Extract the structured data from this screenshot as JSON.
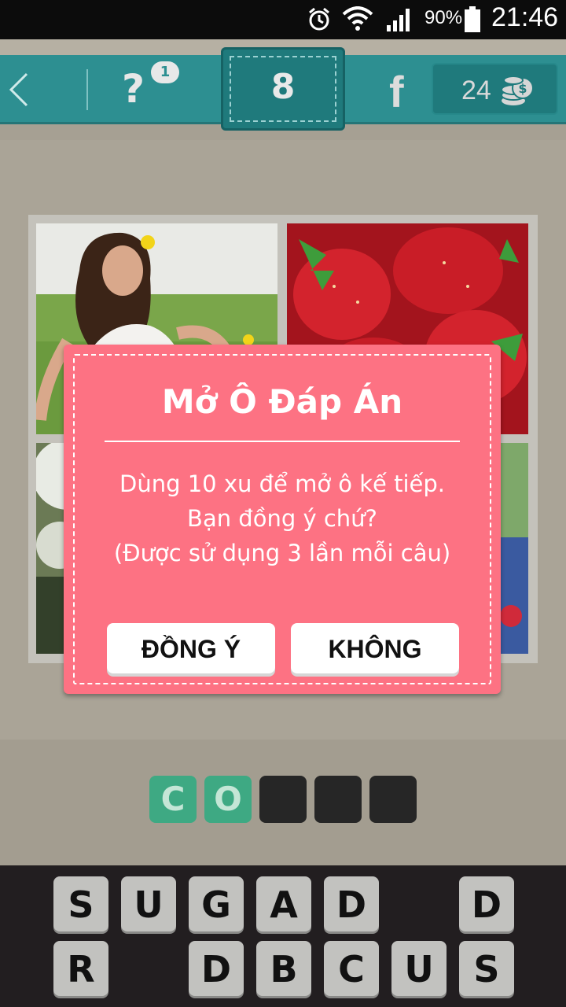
{
  "status_bar": {
    "battery": "90%",
    "time": "21:46"
  },
  "toolbar": {
    "hint_symbol": "?",
    "hint_count": "1",
    "level": "8",
    "facebook_label": "f",
    "coins": "24"
  },
  "dialog": {
    "title": "Mở Ô Đáp Án",
    "line1": "Dùng 10 xu để mở ô kế tiếp.",
    "line2": "Bạn đồng ý chứ?",
    "line3": "(Được sử dụng 3 lần mỗi câu)",
    "confirm_label": "ĐỒNG Ý",
    "cancel_label": "KHÔNG"
  },
  "answer": {
    "slots": [
      "C",
      "O",
      "",
      "",
      ""
    ]
  },
  "keyboard": {
    "row1": [
      "S",
      "U",
      "G",
      "A",
      "D",
      "",
      "D"
    ],
    "row2": [
      "R",
      "",
      "D",
      "B",
      "C",
      "U",
      "S"
    ]
  },
  "colors": {
    "teal": "#2d8f91",
    "dialog_pink": "#fd7283",
    "slot_green": "#3ea983"
  }
}
